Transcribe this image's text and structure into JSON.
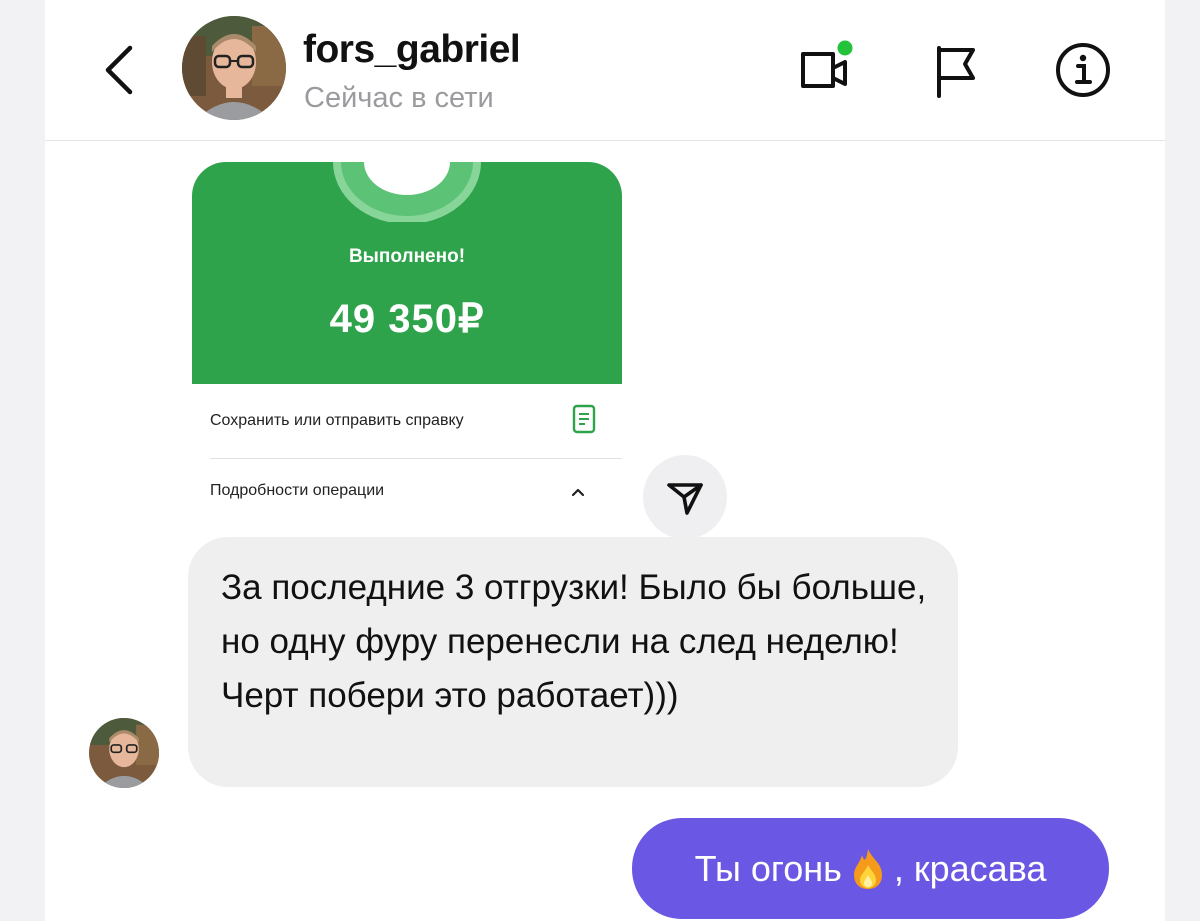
{
  "header": {
    "username": "fors_gabriel",
    "status": "Сейчас в сети",
    "icons": [
      "back-icon",
      "video-call-icon",
      "report-flag-icon",
      "info-icon"
    ],
    "online_dot_color": "#22c33a"
  },
  "payment": {
    "status": "Выполнено!",
    "amount": "49 350₽",
    "save_label": "Сохранить или отправить справку",
    "details_label": "Подробности операции",
    "accent": "#2fa34b"
  },
  "messages": [
    {
      "direction": "incoming",
      "text": "За последние 3 отгрузки! Было бы больше, но одну фуру перенесли на след неделю! Черт побери это работает)))"
    },
    {
      "direction": "outgoing",
      "text_before": "Ты огонь",
      "emoji": "fire-icon",
      "text_after": ", красава",
      "color": "#6a57e3"
    }
  ]
}
